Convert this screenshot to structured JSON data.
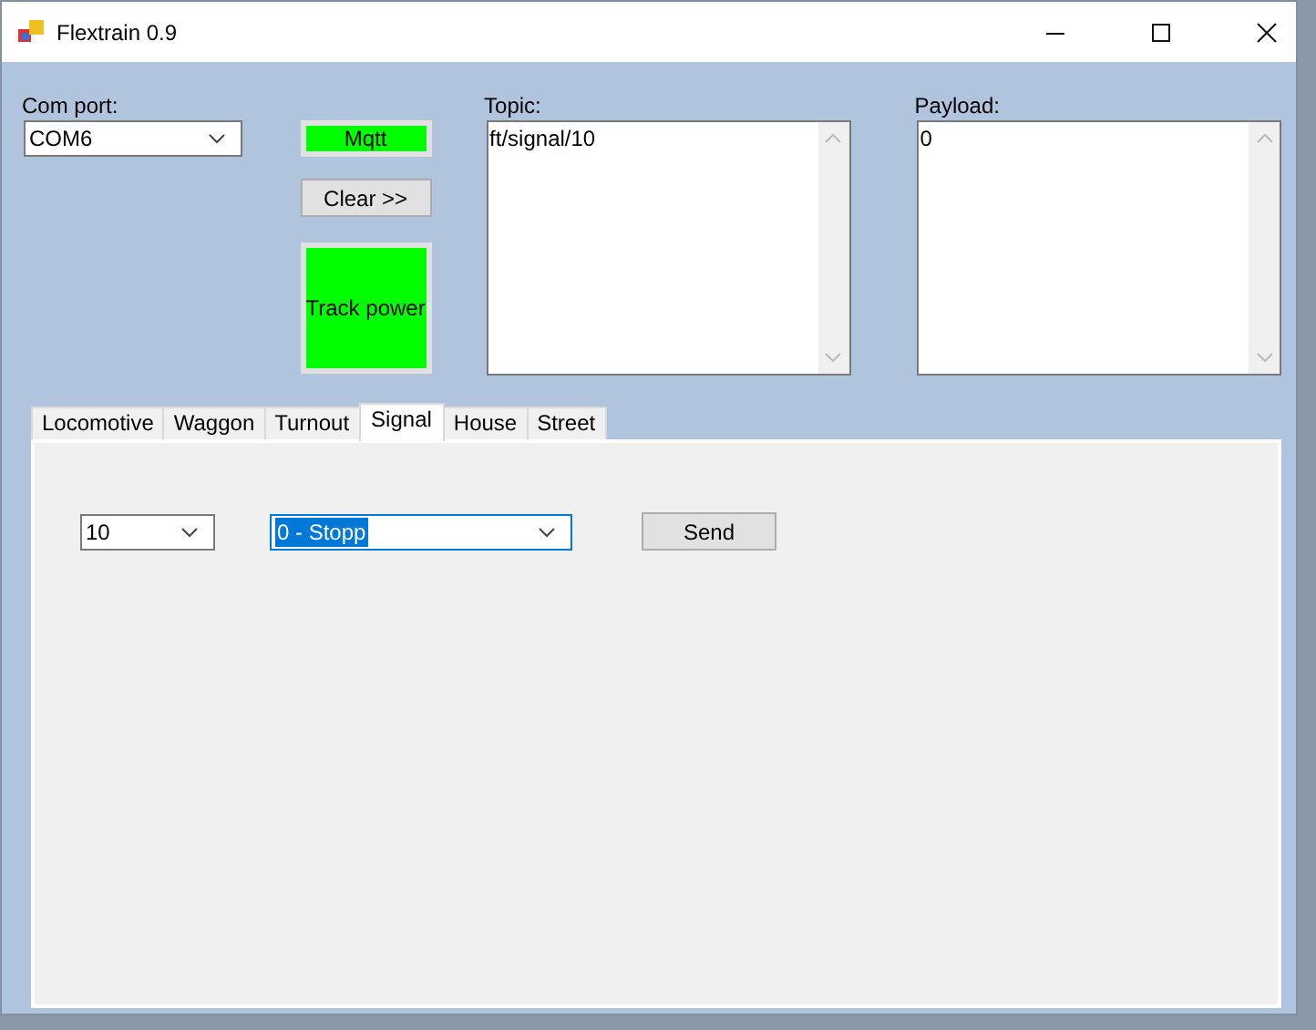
{
  "window": {
    "title": "Flextrain 0.9"
  },
  "com_port": {
    "label": "Com port:",
    "value": "COM6"
  },
  "buttons": [
    {
      "label": "Mqtt",
      "active": true
    },
    {
      "label": "Clear >>",
      "active": false
    },
    {
      "label": "Track power",
      "active": true
    }
  ],
  "topic": {
    "label": "Topic:",
    "value": "ft/signal/10"
  },
  "payload": {
    "label": "Payload:",
    "value": "0"
  },
  "tabs": [
    {
      "label": "Locomotive",
      "selected": false
    },
    {
      "label": "Waggon",
      "selected": false
    },
    {
      "label": "Turnout",
      "selected": false
    },
    {
      "label": "Signal",
      "selected": true
    },
    {
      "label": "House",
      "selected": false
    },
    {
      "label": "Street",
      "selected": false
    }
  ],
  "signal_panel": {
    "address": {
      "value": "10",
      "focused": false
    },
    "aspect": {
      "value": "0 - Stopp",
      "focused": true
    },
    "send": "Send"
  }
}
